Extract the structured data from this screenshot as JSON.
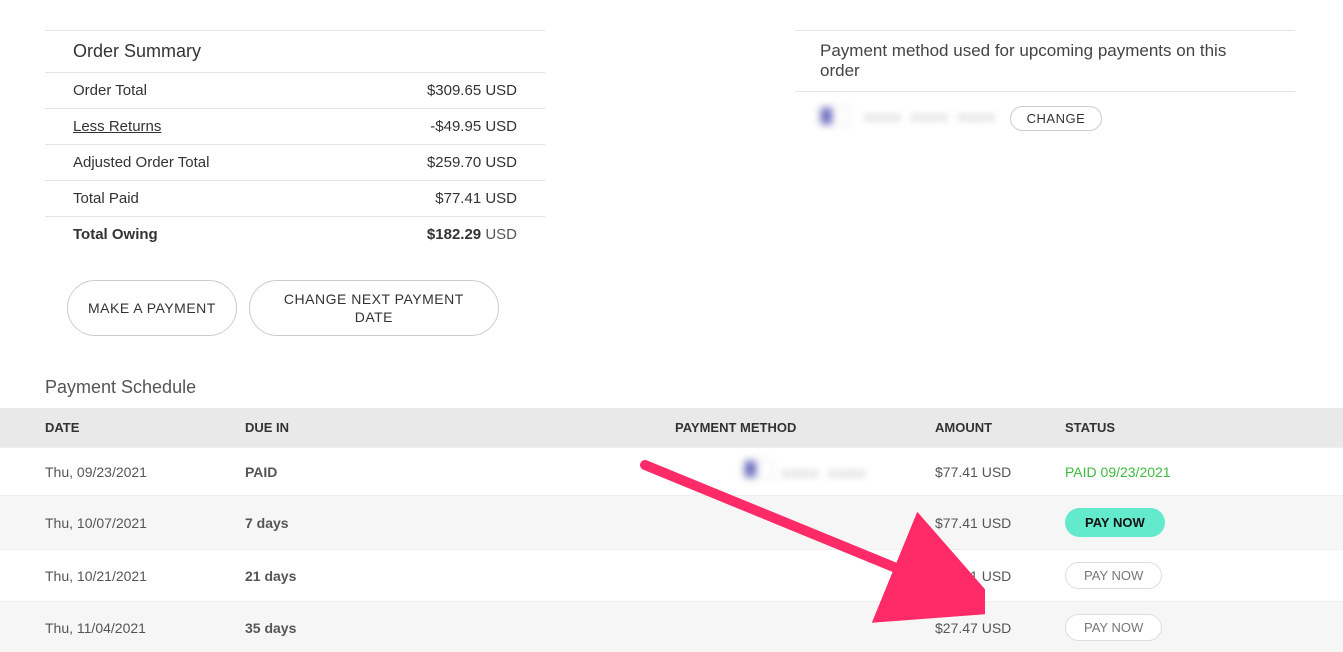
{
  "summary": {
    "title": "Order Summary",
    "rows": [
      {
        "label": "Order Total",
        "value": "$309.65 USD"
      },
      {
        "label": "Less Returns",
        "value": "-$49.95 USD"
      },
      {
        "label": "Adjusted Order Total",
        "value": "$259.70 USD"
      },
      {
        "label": "Total Paid",
        "value": "$77.41 USD"
      }
    ],
    "owing_label": "Total Owing",
    "owing_value_bold": "$182.29",
    "owing_value_suffix": "USD"
  },
  "buttons": {
    "make_payment": "MAKE A PAYMENT",
    "change_next_date": "CHANGE NEXT PAYMENT DATE"
  },
  "payment_method_panel": {
    "title": "Payment method used for upcoming payments on this order",
    "masked_text": "•••• •••• ••••",
    "change_label": "CHANGE"
  },
  "schedule": {
    "title": "Payment Schedule",
    "columns": {
      "date": "DATE",
      "due": "DUE IN",
      "pm": "PAYMENT METHOD",
      "amount": "AMOUNT",
      "status": "STATUS"
    },
    "rows": [
      {
        "date": "Thu, 09/23/2021",
        "due": "PAID",
        "pm_masked": "•••• ••••",
        "amount": "$77.41 USD",
        "status_type": "paid",
        "status_text": "PAID 09/23/2021"
      },
      {
        "date": "Thu, 10/07/2021",
        "due": "7 days",
        "pm_masked": "",
        "amount": "$77.41 USD",
        "status_type": "paynow_active",
        "status_text": "PAY NOW"
      },
      {
        "date": "Thu, 10/21/2021",
        "due": "21 days",
        "pm_masked": "",
        "amount": "$77.41 USD",
        "status_type": "paynow_inactive",
        "status_text": "PAY NOW"
      },
      {
        "date": "Thu, 11/04/2021",
        "due": "35 days",
        "pm_masked": "",
        "amount": "$27.47 USD",
        "status_type": "paynow_inactive",
        "status_text": "PAY NOW"
      }
    ]
  },
  "annotation": {
    "arrow_color": "#ff2a68"
  }
}
